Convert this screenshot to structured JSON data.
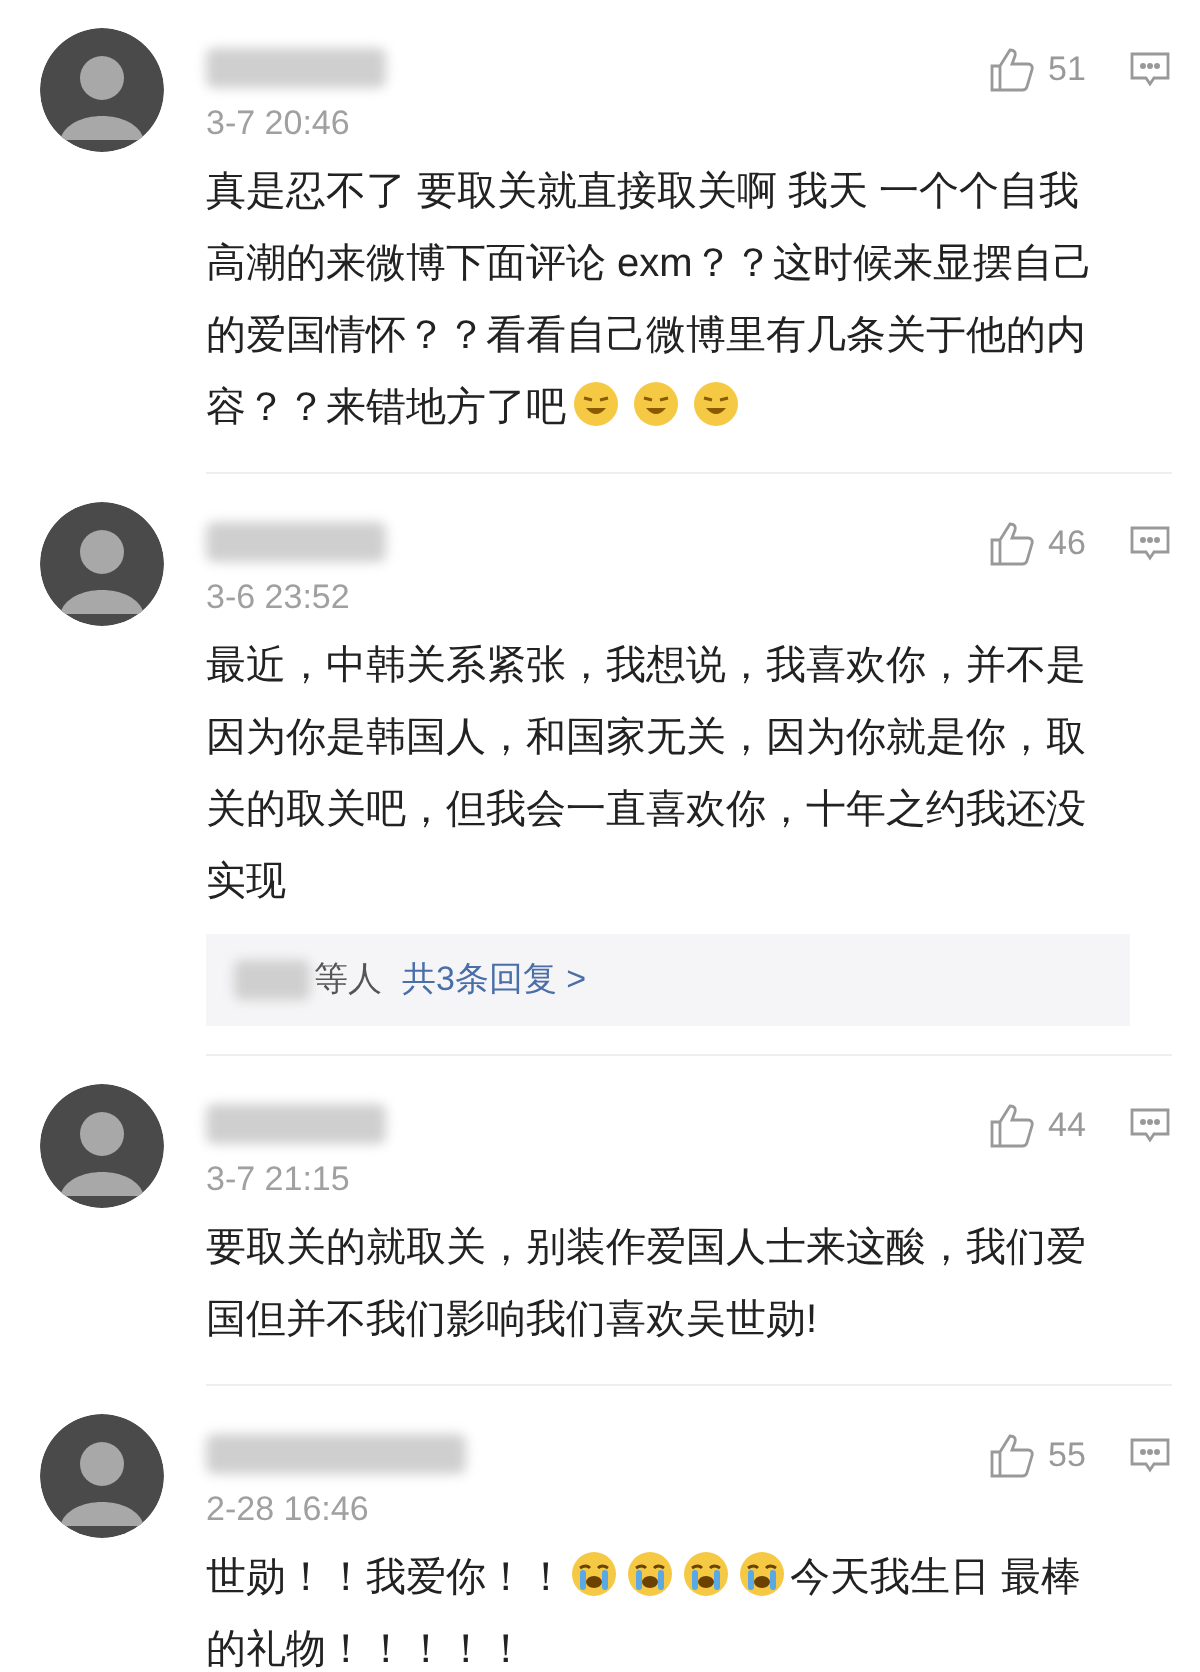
{
  "comments": [
    {
      "time": "3-7 20:46",
      "likes": "51",
      "body": [
        {
          "kind": "text",
          "text": "真是忍不了  要取关就直接取关啊 我天 一个个自我高潮的来微博下面评论 exm？？这时候来显摆自己的爱国情怀？？看看自己微博里有几条关于他的内容？？来错地方了吧"
        },
        {
          "kind": "laugh"
        },
        {
          "kind": "laugh"
        },
        {
          "kind": "laugh"
        }
      ]
    },
    {
      "time": "3-6 23:52",
      "likes": "46",
      "body": [
        {
          "kind": "text",
          "text": "最近，中韩关系紧张，我想说，我喜欢你，并不是因为你是韩国人，和国家无关，因为你就是你，取关的取关吧，但我会一直喜欢你，十年之约我还没实现"
        }
      ],
      "replies": {
        "suffix": "等人",
        "link": "共3条回复 >"
      }
    },
    {
      "time": "3-7 21:15",
      "likes": "44",
      "body": [
        {
          "kind": "text",
          "text": "要取关的就取关，别装作爱国人士来这酸，我们爱国但并不我们影响我们喜欢吴世勋!"
        }
      ]
    },
    {
      "time": "2-28 16:46",
      "likes": "55",
      "body": [
        {
          "kind": "text",
          "text": "世勋！！我爱你！！"
        },
        {
          "kind": "cry"
        },
        {
          "kind": "cry"
        },
        {
          "kind": "cry"
        },
        {
          "kind": "cry"
        },
        {
          "kind": "text",
          "text": "今天我生日 最棒的礼物！！！！！"
        }
      ]
    }
  ]
}
